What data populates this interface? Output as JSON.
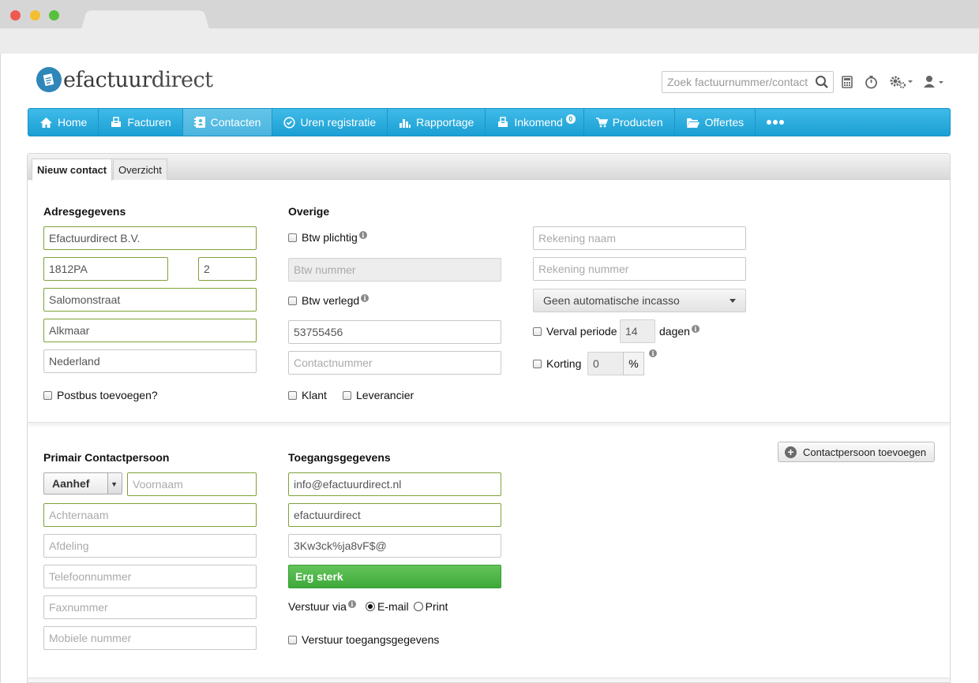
{
  "app": {
    "logo_light": "efactuur",
    "logo_dark": "direct"
  },
  "search": {
    "placeholder": "Zoek factuurnummer/contact"
  },
  "nav": {
    "items": [
      {
        "label": "Home"
      },
      {
        "label": "Facturen"
      },
      {
        "label": "Contacten"
      },
      {
        "label": "Uren registratie"
      },
      {
        "label": "Rapportage"
      },
      {
        "label": "Inkomend",
        "badge": "0"
      },
      {
        "label": "Producten"
      },
      {
        "label": "Offertes"
      }
    ]
  },
  "tabs": {
    "new_contact": "Nieuw contact",
    "overview": "Overzicht"
  },
  "address": {
    "heading": "Adresgegevens",
    "company": "Efactuurdirect B.V.",
    "zip": "1812PA",
    "house_number": "2",
    "street": "Salomonstraat",
    "city": "Alkmaar",
    "country": "Nederland",
    "po_box_label": "Postbus toevoegen?"
  },
  "other": {
    "heading": "Overige",
    "vat_liable_label": "Btw plichtig",
    "vat_number_placeholder": "Btw nummer",
    "vat_shifted_label": "Btw verlegd",
    "number_value": "53755456",
    "contact_number_placeholder": "Contactnummer",
    "customer_label": "Klant",
    "supplier_label": "Leverancier"
  },
  "bank": {
    "account_name_placeholder": "Rekening naam",
    "account_number_placeholder": "Rekening nummer",
    "direct_debit": "Geen automatische incasso",
    "due_period_label": "Verval periode",
    "due_period_value": "14",
    "days_label": "dagen",
    "discount_label": "Korting",
    "discount_value": "0",
    "percent": "%"
  },
  "contact": {
    "heading": "Primair Contactpersoon",
    "salutation": "Aanhef",
    "first_name_placeholder": "Voornaam",
    "last_name_placeholder": "Achternaam",
    "department_placeholder": "Afdeling",
    "phone_placeholder": "Telefoonnummer",
    "fax_placeholder": "Faxnummer",
    "mobile_placeholder": "Mobiele nummer",
    "add_button": "Contactpersoon toevoegen"
  },
  "access": {
    "heading": "Toegangsgegevens",
    "email": "info@efactuurdirect.nl",
    "username": "efactuurdirect",
    "password": "3Kw3ck%ja8vF$@",
    "strength": "Erg sterk",
    "send_via_label": "Verstuur via",
    "email_option": "E-mail",
    "print_option": "Print",
    "send_credentials_label": "Verstuur toegangsgegevens"
  },
  "colors": {
    "nav": "#2aabde",
    "valid_border": "#7fa23a",
    "strength": "#4cb446"
  }
}
